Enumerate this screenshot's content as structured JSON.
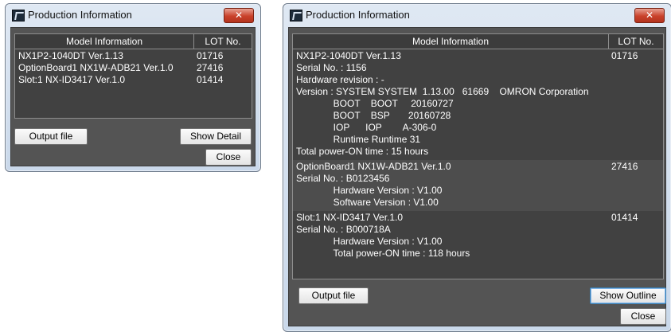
{
  "left_window": {
    "title": "Production Information",
    "close_glyph": "✕",
    "columns": {
      "model": "Model Information",
      "lot": "LOT No."
    },
    "rows": [
      {
        "model": "NX1P2-1040DT Ver.1.13",
        "lot": "01716"
      },
      {
        "model": "OptionBoard1 NX1W-ADB21 Ver.1.0",
        "lot": "27416"
      },
      {
        "model": "Slot:1 NX-ID3417 Ver.1.0",
        "lot": "01414"
      }
    ],
    "buttons": {
      "output": "Output file",
      "detail": "Show Detail",
      "close": "Close"
    }
  },
  "right_window": {
    "title": "Production Information",
    "close_glyph": "✕",
    "columns": {
      "model": "Model Information",
      "lot": "LOT No."
    },
    "groups": [
      {
        "lot": "01716",
        "lines": [
          "NX1P2-1040DT Ver.1.13",
          "Serial No. : 1156",
          "Hardware revision : -",
          "Version : SYSTEM SYSTEM  1.13.00   61669    OMRON Corporation",
          "              BOOT    BOOT     20160727",
          "              BOOT    BSP       20160728",
          "              IOP      IOP        A-306-0",
          "              Runtime Runtime 31",
          "Total power-ON time : 15 hours"
        ]
      },
      {
        "lot": "27416",
        "lines": [
          "OptionBoard1 NX1W-ADB21 Ver.1.0",
          "Serial No. : B0123456",
          "              Hardware Version : V1.00",
          "              Software Version : V1.00"
        ]
      },
      {
        "lot": "01414",
        "lines": [
          "Slot:1 NX-ID3417 Ver.1.0",
          "Serial No. : B000718A",
          "              Hardware Version : V1.00",
          "              Total power-ON time : 118 hours"
        ]
      }
    ],
    "buttons": {
      "output": "Output file",
      "outline": "Show Outline",
      "close": "Close"
    }
  },
  "colors": {
    "client_bg": "#545454",
    "table_bg": "#414141",
    "title_bar": "#c9d8ea",
    "close_red": "#c9412a"
  }
}
